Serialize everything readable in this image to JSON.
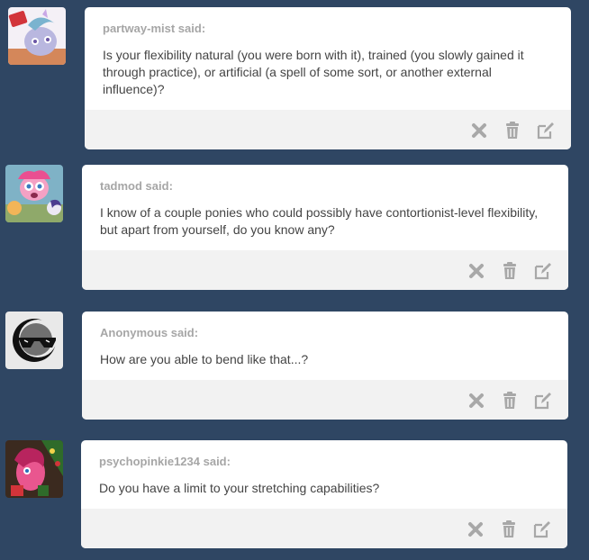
{
  "colors": {
    "background": "#2f4663",
    "card": "#ffffff",
    "footer": "#f2f2f2",
    "icon": "#a8a8a8",
    "asker": "#a6a6a6",
    "text": "#444444"
  },
  "posts": [
    {
      "asker_label": "partway-mist said:",
      "question": "Is your flexibility natural (you were born with it), trained (you slowly gained it through practice), or artificial (a spell of some sort, or another external influence)?",
      "actions": [
        "delete-icon",
        "trash-icon",
        "edit-icon"
      ]
    },
    {
      "asker_label": "tadmod said:",
      "question": "I know of a couple ponies who could possibly have contortionist-level flexibility, but apart from yourself, do you know any?",
      "actions": [
        "delete-icon",
        "trash-icon",
        "edit-icon"
      ]
    },
    {
      "asker_label": "Anonymous said:",
      "question": "How are you able to bend like that...?",
      "actions": [
        "delete-icon",
        "trash-icon",
        "edit-icon"
      ]
    },
    {
      "asker_label": "psychopinkie1234 said:",
      "question": "Do you have a limit to your stretching capabilities?",
      "actions": [
        "delete-icon",
        "trash-icon",
        "edit-icon"
      ]
    }
  ]
}
